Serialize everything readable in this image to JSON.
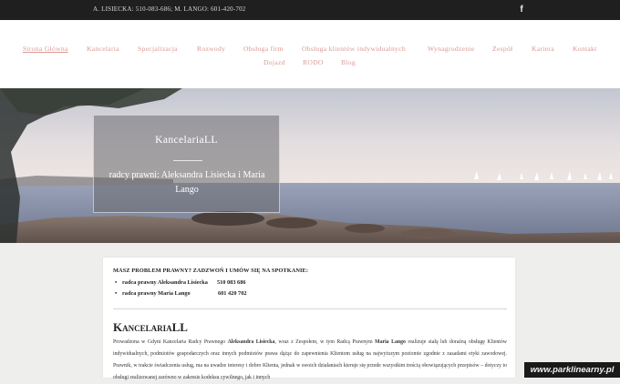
{
  "topbar": {
    "contact": "A. LISIECKA: 510-083-686; M. LANGO: 601-420-702",
    "facebook_icon": "facebook-icon",
    "facebook_glyph": "f"
  },
  "nav": {
    "row1": [
      "Strona Główna",
      "Kancelaria",
      "Specjalizacja",
      "Rozwody",
      "Obsługa firm",
      "Obsługa klientów indywidualnych",
      "Wynagrodzenie",
      "Zespół",
      "Kariera",
      "Kontakt"
    ],
    "row2": [
      "Dojazd",
      "RODO",
      "Blog"
    ],
    "active": "Strona Główna",
    "link_color": "#d99a94"
  },
  "hero": {
    "title": "KancelariaLL",
    "subtitle": "radcy prawni: Aleksandra Lisiecka i Maria Lango"
  },
  "content": {
    "problem_heading": "MASZ PROBLEM PRAWNY? ZADZWOŃ I UMÓW SIĘ NA SPOTKANIE:",
    "contacts": [
      {
        "name": "radca prawny Aleksandra Lisiecka",
        "phone": "510 083 686"
      },
      {
        "name": "radca prawny Maria Lango",
        "phone": "601 420 702"
      }
    ],
    "bullet": "•",
    "section_title": "KancelariaLL",
    "paragraph": {
      "p1": "Prowadzona w Gdyni Kancelaria Radcy Prawnego ",
      "b1": "Aleksandra Lisiecka",
      "p2": ", wraz z Zespołem, w tym Radcą Prawnym ",
      "b2": "Maria Lango",
      "p3": " realizuje stałą lub doraźną obsługę Klientów indywidualnych, podmiotów gospodarczych oraz innych podmiotów prawa dążąc do zapewnienia Klientom usług na najwyższym poziomie zgodnie z zasadami etyki zawodowej. Prawnik, w trakcie świadczenia usług, ma na uwadze interesy i dobro Klienta, jednak w swoich działaniach kieruje się przede wszystkim treścią obowiązujących przepisów – dotyczy to obsługi realizowanej zarówno w zakresie kodeksu cywilnego, jak i innych"
    }
  },
  "watermark": "www.parklinearny.pl"
}
